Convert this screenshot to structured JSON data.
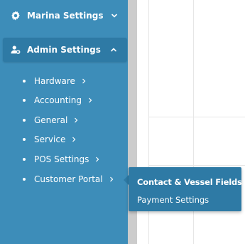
{
  "sidebar": {
    "marina_settings": {
      "label": "Marina Settings",
      "icon": "gear-icon",
      "expanded": false
    },
    "admin_settings": {
      "label": "Admin Settings",
      "icon": "user-gear-icon",
      "expanded": true
    },
    "items": [
      {
        "label": "Hardware"
      },
      {
        "label": "Accounting"
      },
      {
        "label": "General"
      },
      {
        "label": "Service"
      },
      {
        "label": "POS Settings"
      },
      {
        "label": "Customer Portal"
      }
    ]
  },
  "flyout": {
    "items": [
      {
        "label": "Contact & Vessel Fields",
        "active": true
      },
      {
        "label": "Payment Settings",
        "active": false
      }
    ]
  },
  "colors": {
    "sidebar_bg": "#3d8db9",
    "active_bg": "#2e7aa5",
    "scroll_strip": "#cccccc",
    "text": "#ffffff"
  }
}
